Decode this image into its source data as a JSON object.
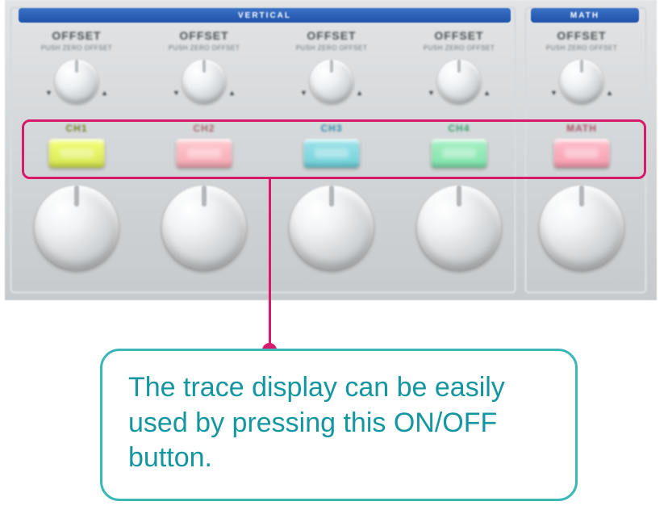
{
  "sections": {
    "vertical": "VERTICAL",
    "math": "MATH"
  },
  "offset": {
    "label": "OFFSET",
    "sub": "PUSH ZERO OFFSET"
  },
  "channels": {
    "ch1": "CH1",
    "ch2": "CH2",
    "ch3": "CH3",
    "ch4": "CH4",
    "math": "MATH"
  },
  "callout": {
    "text": "The trace display can be easily used by pressing this ON/OFF button."
  }
}
